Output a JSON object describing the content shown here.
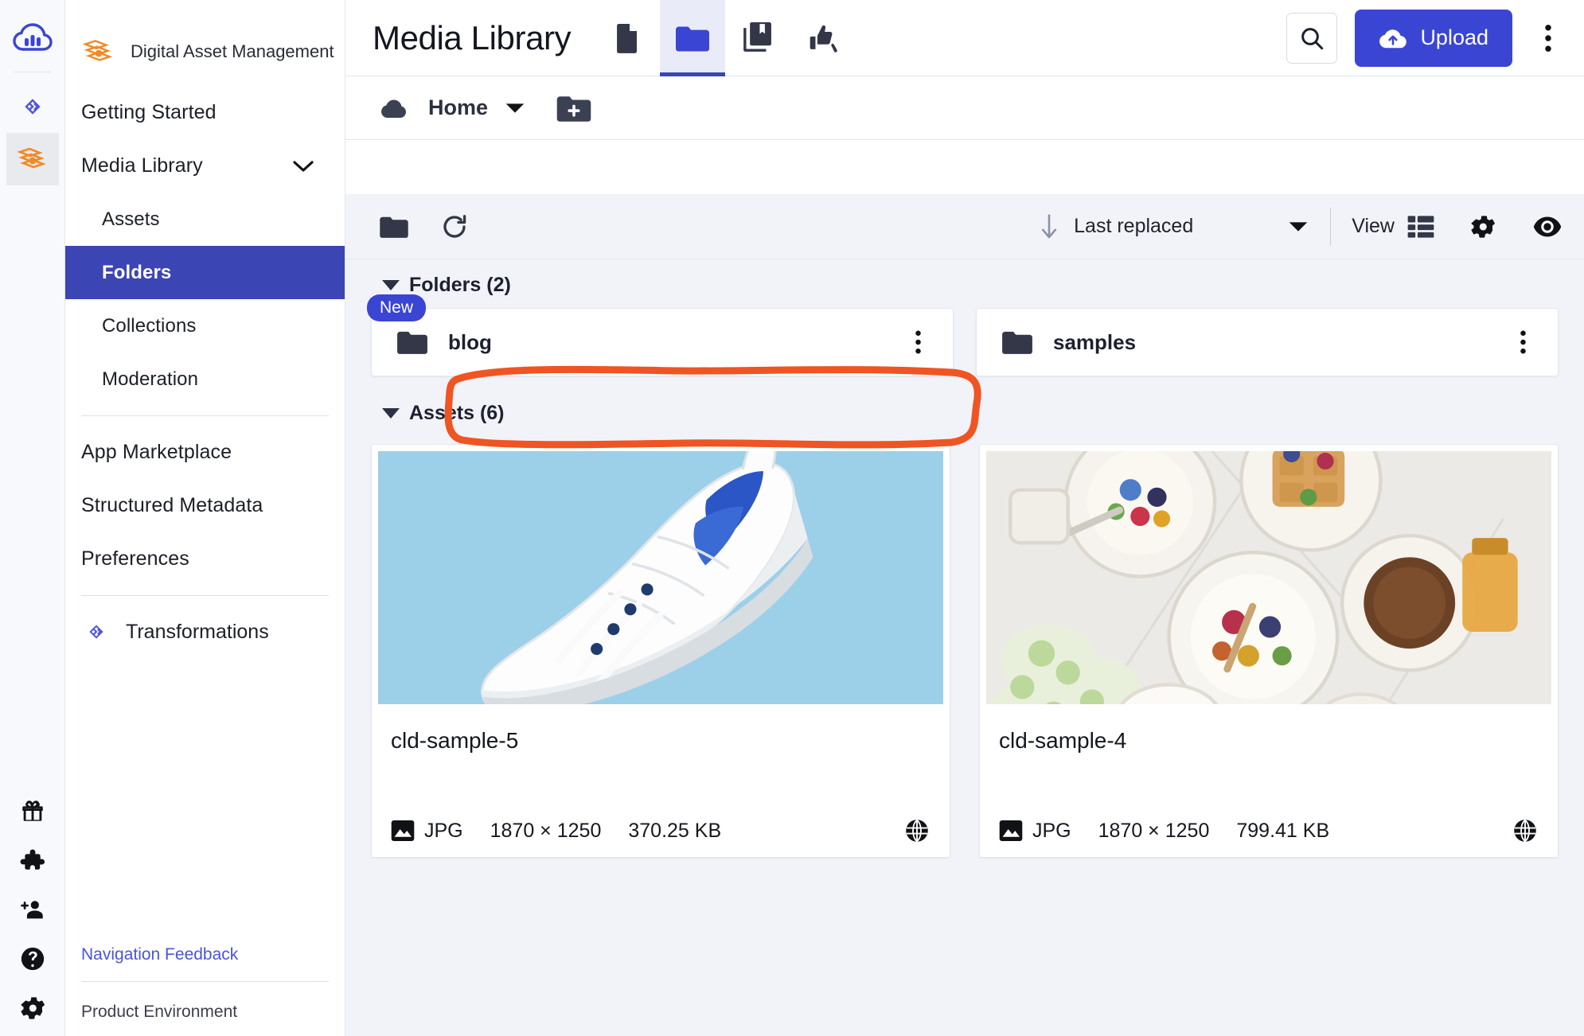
{
  "rail": {
    "logo_icon": "cloudinary-cloud-logo",
    "items": [
      {
        "icon": "transformations-chevrons-icon",
        "active": false
      },
      {
        "icon": "digital-asset-management-icon",
        "active": true
      }
    ],
    "bottom_items": [
      {
        "icon": "gift-icon",
        "label": "Gift"
      },
      {
        "icon": "puzzle-icon",
        "label": "Extensions"
      },
      {
        "icon": "add-user-icon",
        "label": "Invite"
      },
      {
        "icon": "help-icon",
        "label": "Help"
      },
      {
        "icon": "settings-gear-icon",
        "label": "Settings"
      }
    ]
  },
  "sidebar": {
    "brand": {
      "icon": "digital-asset-management-icon",
      "label": "Digital Asset Management"
    },
    "items": [
      {
        "label": "Getting Started",
        "indent": false,
        "active": false,
        "chevron": null
      },
      {
        "label": "Media Library",
        "indent": false,
        "active": false,
        "chevron": "chevron-down-icon"
      },
      {
        "label": "Assets",
        "indent": true,
        "active": false,
        "chevron": null
      },
      {
        "label": "Folders",
        "indent": true,
        "active": true,
        "chevron": null
      },
      {
        "label": "Collections",
        "indent": true,
        "active": false,
        "chevron": null
      },
      {
        "label": "Moderation",
        "indent": true,
        "active": false,
        "chevron": null
      }
    ],
    "items_lower": [
      {
        "label": "App Marketplace"
      },
      {
        "label": "Structured Metadata"
      },
      {
        "label": "Preferences"
      }
    ],
    "transformations": {
      "icon": "transformations-chevrons-icon",
      "label": "Transformations"
    },
    "feedback_link": "Navigation Feedback",
    "environment_label": "Product Environment"
  },
  "header": {
    "title": "Media Library",
    "tabs": [
      {
        "name": "assets",
        "icon": "file-icon",
        "active": false
      },
      {
        "name": "folders",
        "icon": "folder-icon",
        "active": true
      },
      {
        "name": "collections",
        "icon": "collections-book-icon",
        "active": false
      },
      {
        "name": "moderation",
        "icon": "thumbs-updown-icon",
        "active": false
      }
    ],
    "search_icon": "search-icon",
    "upload_label": "Upload",
    "upload_icon": "cloud-upload-icon",
    "overflow_icon": "kebab-menu-icon"
  },
  "breadcrumb": {
    "home_icon": "cloud-icon",
    "home_label": "Home",
    "dropdown_icon": "caret-down-icon",
    "new_folder_icon": "new-folder-icon"
  },
  "toolbar": {
    "folder_tree_icon": "folder-icon",
    "refresh_icon": "refresh-icon",
    "sort_direction_icon": "arrow-down-icon",
    "sort_label": "Last replaced",
    "sort_caret_icon": "caret-down-icon",
    "view_label": "View",
    "view_list_icon": "list-view-icon",
    "settings_icon": "gear-icon",
    "preview_icon": "eye-icon"
  },
  "content": {
    "folders_section": {
      "label": "Folders (2)",
      "items": [
        {
          "name": "blog",
          "badge": "New",
          "icon": "folder-icon",
          "menu_icon": "kebab-menu-icon"
        },
        {
          "name": "samples",
          "badge": null,
          "icon": "folder-icon",
          "menu_icon": "kebab-menu-icon"
        }
      ]
    },
    "assets_section": {
      "label": "Assets (6)",
      "items": [
        {
          "name": "cld-sample-5",
          "format": "JPG",
          "dimensions": "1870 × 1250",
          "size": "370.25 KB",
          "type_icon": "image-icon",
          "delivery_icon": "globe-icon",
          "thumb": "white-sneaker-on-light-blue-background"
        },
        {
          "name": "cld-sample-4",
          "format": "JPG",
          "dimensions": "1870 × 1250",
          "size": "799.41 KB",
          "type_icon": "image-icon",
          "delivery_icon": "globe-icon",
          "thumb": "breakfast-waffles-berries-flatlay"
        }
      ]
    }
  },
  "annotation": {
    "shape": "hand-drawn-orange-rectangle",
    "color": "#ef5423",
    "targets": "blog folder card"
  },
  "colors": {
    "accent_blue": "#3b45d4",
    "active_nav": "#3b45b4",
    "annotation_orange": "#ef5423",
    "icon_dark": "#333747"
  }
}
